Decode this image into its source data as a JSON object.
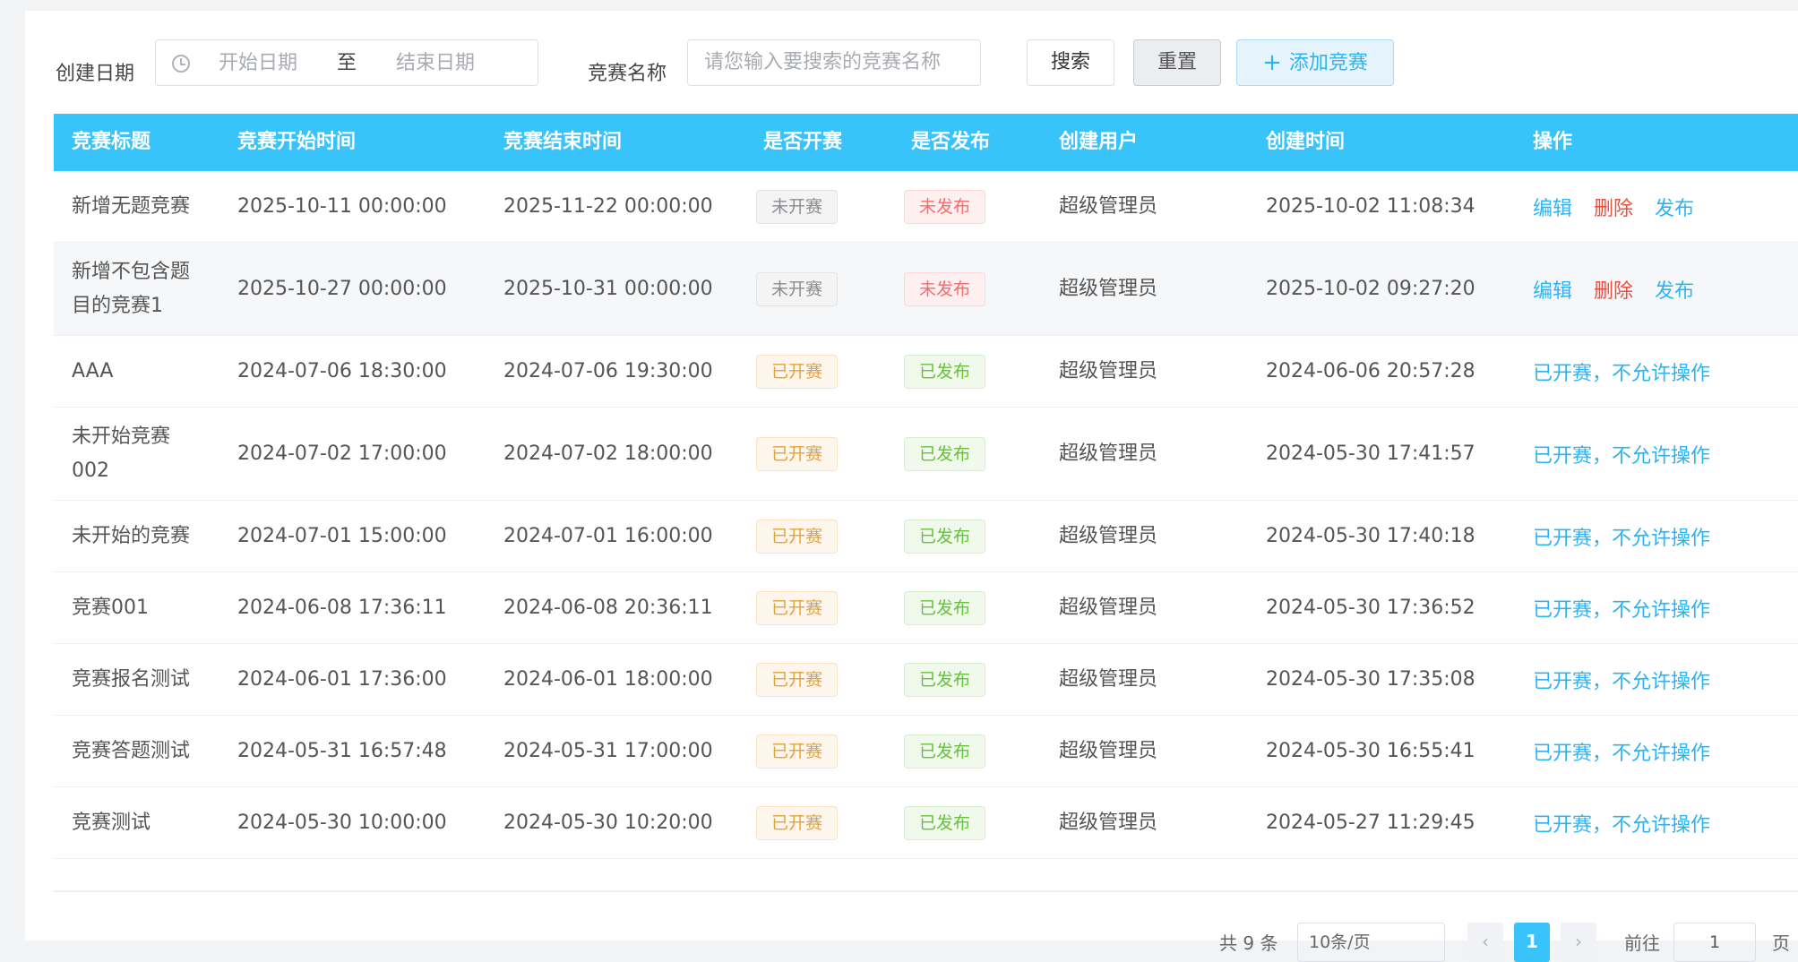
{
  "filter": {
    "created_date_label": "创建日期",
    "start_placeholder": "开始日期",
    "range_separator": "至",
    "end_placeholder": "结束日期",
    "name_label": "竞赛名称",
    "name_placeholder": "请您输入要搜索的竞赛名称",
    "search_label": "搜索",
    "reset_label": "重置",
    "add_label": "添加竞赛",
    "add_icon": "plus-icon"
  },
  "table": {
    "headers": [
      "竞赛标题",
      "竞赛开始时间",
      "竞赛结束时间",
      "是否开赛",
      "是否发布",
      "创建用户",
      "创建时间",
      "操作"
    ],
    "rows": [
      {
        "title": "新增无题竞赛",
        "start": "2025-10-11 00:00:00",
        "end": "2025-11-22 00:00:00",
        "started": "未开赛",
        "published": "未发布",
        "user": "超级管理员",
        "created": "2025-10-02 11:08:34",
        "ops": [
          "编辑",
          "删除",
          "发布"
        ]
      },
      {
        "title": "新增不包含题目的竞赛1",
        "start": "2025-10-27 00:00:00",
        "end": "2025-10-31 00:00:00",
        "started": "未开赛",
        "published": "未发布",
        "user": "超级管理员",
        "created": "2025-10-02 09:27:20",
        "ops": [
          "编辑",
          "删除",
          "发布"
        ]
      },
      {
        "title": "AAA",
        "start": "2024-07-06 18:30:00",
        "end": "2024-07-06 19:30:00",
        "started": "已开赛",
        "published": "已发布",
        "user": "超级管理员",
        "created": "2024-06-06 20:57:28",
        "note": "已开赛，不允许操作"
      },
      {
        "title": "未开始竞赛002",
        "start": "2024-07-02 17:00:00",
        "end": "2024-07-02 18:00:00",
        "started": "已开赛",
        "published": "已发布",
        "user": "超级管理员",
        "created": "2024-05-30 17:41:57",
        "note": "已开赛，不允许操作"
      },
      {
        "title": "未开始的竞赛",
        "start": "2024-07-01 15:00:00",
        "end": "2024-07-01 16:00:00",
        "started": "已开赛",
        "published": "已发布",
        "user": "超级管理员",
        "created": "2024-05-30 17:40:18",
        "note": "已开赛，不允许操作"
      },
      {
        "title": "竞赛001",
        "start": "2024-06-08 17:36:11",
        "end": "2024-06-08 20:36:11",
        "started": "已开赛",
        "published": "已发布",
        "user": "超级管理员",
        "created": "2024-05-30 17:36:52",
        "note": "已开赛，不允许操作"
      },
      {
        "title": "竞赛报名测试",
        "start": "2024-06-01 17:36:00",
        "end": "2024-06-01 18:00:00",
        "started": "已开赛",
        "published": "已发布",
        "user": "超级管理员",
        "created": "2024-05-30 17:35:08",
        "note": "已开赛，不允许操作"
      },
      {
        "title": "竞赛答题测试",
        "start": "2024-05-31 16:57:48",
        "end": "2024-05-31 17:00:00",
        "started": "已开赛",
        "published": "已发布",
        "user": "超级管理员",
        "created": "2024-05-30 16:55:41",
        "note": "已开赛，不允许操作"
      },
      {
        "title": "竞赛测试",
        "start": "2024-05-30 10:00:00",
        "end": "2024-05-30 10:20:00",
        "started": "已开赛",
        "published": "已发布",
        "user": "超级管理员",
        "created": "2024-05-27 11:29:45",
        "note": "已开赛，不允许操作"
      }
    ]
  },
  "pagination": {
    "total_text": "共 9 条",
    "page_size": "10条/页",
    "current_page": "1",
    "goto_label": "前往",
    "goto_value": "1",
    "page_suffix": "页"
  },
  "colors": {
    "header_bg": "#38c3fb",
    "link_blue": "#2fb3f0",
    "delete_red": "#f04a3b"
  }
}
